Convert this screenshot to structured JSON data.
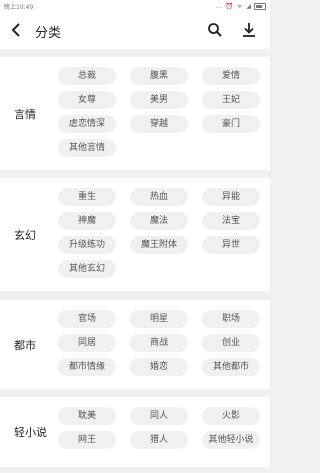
{
  "status_bar": {
    "time": "晚上10:49",
    "icons": "… ⏰ ᯤ ◢"
  },
  "toolbar": {
    "back_icon": "‹",
    "title": "分类"
  },
  "sections": [
    {
      "label": "言情",
      "tags": [
        "总裁",
        "腹黑",
        "爱情",
        "女尊",
        "美男",
        "王妃",
        "虐恋情深",
        "穿越",
        "豪门",
        "其他言情"
      ]
    },
    {
      "label": "玄幻",
      "tags": [
        "重生",
        "热血",
        "异能",
        "神魔",
        "魔法",
        "法宝",
        "升级练功",
        "魔王附体",
        "异世",
        "其他玄幻"
      ]
    },
    {
      "label": "都市",
      "tags": [
        "官场",
        "明星",
        "职场",
        "同居",
        "商战",
        "创业",
        "都市情缘",
        "婚恋",
        "其他都市"
      ]
    },
    {
      "label": "轻小说",
      "tags": [
        "耽美",
        "同人",
        "火影",
        "网王",
        "猎人",
        "其他轻小说"
      ]
    }
  ]
}
